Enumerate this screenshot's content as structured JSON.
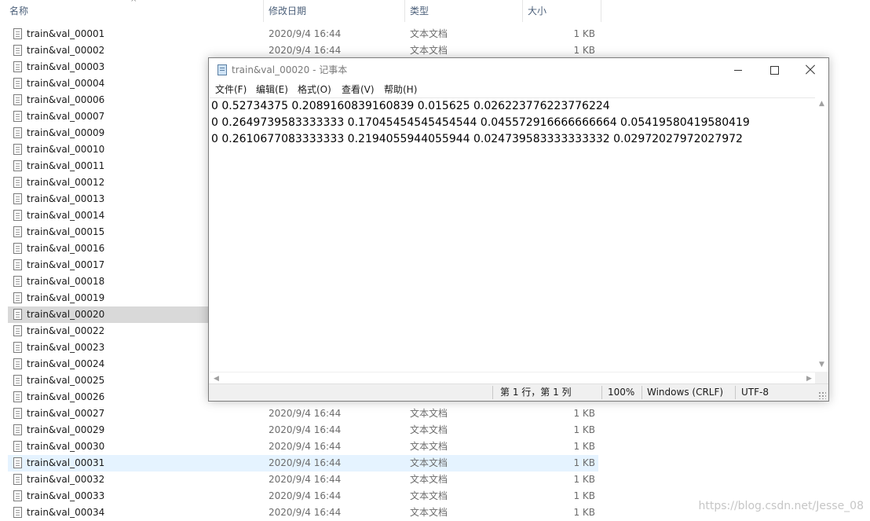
{
  "explorer": {
    "headers": {
      "name": "名称",
      "date": "修改日期",
      "type": "类型",
      "size": "大小"
    },
    "sort_indicator": "^",
    "rows": [
      {
        "name": "train&val_00001",
        "date": "2020/9/4 16:44",
        "type": "文本文档",
        "size": "1 KB",
        "state": "normal"
      },
      {
        "name": "train&val_00002",
        "date": "2020/9/4 16:44",
        "type": "文本文档",
        "size": "1 KB",
        "state": "normal"
      },
      {
        "name": "train&val_00003",
        "date": "",
        "type": "",
        "size": "",
        "state": "normal"
      },
      {
        "name": "train&val_00004",
        "date": "",
        "type": "",
        "size": "",
        "state": "normal"
      },
      {
        "name": "train&val_00006",
        "date": "",
        "type": "",
        "size": "",
        "state": "normal"
      },
      {
        "name": "train&val_00007",
        "date": "",
        "type": "",
        "size": "",
        "state": "normal"
      },
      {
        "name": "train&val_00009",
        "date": "",
        "type": "",
        "size": "",
        "state": "normal"
      },
      {
        "name": "train&val_00010",
        "date": "",
        "type": "",
        "size": "",
        "state": "normal"
      },
      {
        "name": "train&val_00011",
        "date": "",
        "type": "",
        "size": "",
        "state": "normal"
      },
      {
        "name": "train&val_00012",
        "date": "",
        "type": "",
        "size": "",
        "state": "normal"
      },
      {
        "name": "train&val_00013",
        "date": "",
        "type": "",
        "size": "",
        "state": "normal"
      },
      {
        "name": "train&val_00014",
        "date": "",
        "type": "",
        "size": "",
        "state": "normal"
      },
      {
        "name": "train&val_00015",
        "date": "",
        "type": "",
        "size": "",
        "state": "normal"
      },
      {
        "name": "train&val_00016",
        "date": "",
        "type": "",
        "size": "",
        "state": "normal"
      },
      {
        "name": "train&val_00017",
        "date": "",
        "type": "",
        "size": "",
        "state": "normal"
      },
      {
        "name": "train&val_00018",
        "date": "",
        "type": "",
        "size": "",
        "state": "normal"
      },
      {
        "name": "train&val_00019",
        "date": "",
        "type": "",
        "size": "",
        "state": "normal"
      },
      {
        "name": "train&val_00020",
        "date": "",
        "type": "",
        "size": "",
        "state": "selected-gray"
      },
      {
        "name": "train&val_00022",
        "date": "",
        "type": "",
        "size": "",
        "state": "normal"
      },
      {
        "name": "train&val_00023",
        "date": "",
        "type": "",
        "size": "",
        "state": "normal"
      },
      {
        "name": "train&val_00024",
        "date": "",
        "type": "",
        "size": "",
        "state": "normal"
      },
      {
        "name": "train&val_00025",
        "date": "",
        "type": "",
        "size": "",
        "state": "normal"
      },
      {
        "name": "train&val_00026",
        "date": "",
        "type": "",
        "size": "",
        "state": "normal"
      },
      {
        "name": "train&val_00027",
        "date": "2020/9/4 16:44",
        "type": "文本文档",
        "size": "1 KB",
        "state": "normal"
      },
      {
        "name": "train&val_00029",
        "date": "2020/9/4 16:44",
        "type": "文本文档",
        "size": "1 KB",
        "state": "normal"
      },
      {
        "name": "train&val_00030",
        "date": "2020/9/4 16:44",
        "type": "文本文档",
        "size": "1 KB",
        "state": "normal"
      },
      {
        "name": "train&val_00031",
        "date": "2020/9/4 16:44",
        "type": "文本文档",
        "size": "1 KB",
        "state": "hover-blue"
      },
      {
        "name": "train&val_00032",
        "date": "2020/9/4 16:44",
        "type": "文本文档",
        "size": "1 KB",
        "state": "normal"
      },
      {
        "name": "train&val_00033",
        "date": "2020/9/4 16:44",
        "type": "文本文档",
        "size": "1 KB",
        "state": "normal"
      },
      {
        "name": "train&val_00034",
        "date": "2020/9/4 16:44",
        "type": "文本文档",
        "size": "1 KB",
        "state": "normal"
      }
    ]
  },
  "notepad": {
    "title": "train&val_00020 - 记事本",
    "icon": "notepad-icon",
    "menu": [
      "文件(F)",
      "编辑(E)",
      "格式(O)",
      "查看(V)",
      "帮助(H)"
    ],
    "lines": [
      "0 0.52734375 0.2089160839160839 0.015625 0.026223776223776224",
      "0 0.2649739583333333 0.17045454545454544 0.045572916666666664 0.05419580419580419",
      "0 0.2610677083333333 0.2194055944055944 0.024739583333333332 0.02972027972027972"
    ],
    "status": {
      "position": "第 1 行，第 1 列",
      "zoom": "100%",
      "line_ending": "Windows (CRLF)",
      "encoding": "UTF-8"
    }
  },
  "watermark": "https://blog.csdn.net/Jesse_08"
}
